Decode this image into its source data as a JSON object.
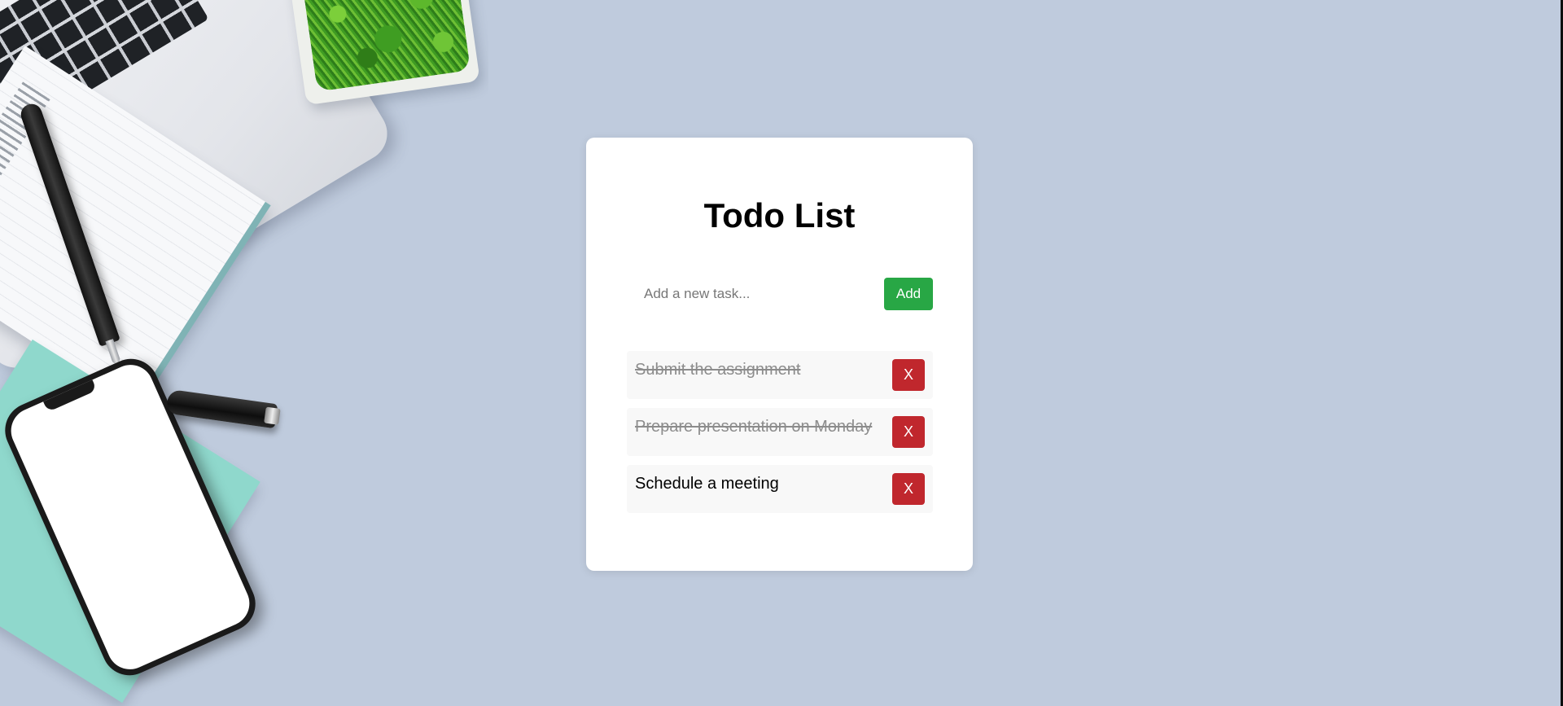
{
  "app": {
    "title": "Todo List",
    "add_label": "Add",
    "input": {
      "value": "",
      "placeholder": "Add a new task..."
    }
  },
  "tasks": [
    {
      "text": "Submit the assignment",
      "completed": true,
      "delete_label": "X"
    },
    {
      "text": "Prepare presentation on Monday",
      "completed": true,
      "delete_label": "X"
    },
    {
      "text": "Schedule a meeting",
      "completed": false,
      "delete_label": "X"
    }
  ],
  "colors": {
    "background": "#bfcbdd",
    "card": "#ffffff",
    "add_button": "#28a745",
    "delete_button": "#c0272d",
    "task_bg": "#f8f8f8",
    "completed_text": "#8c8c8c"
  }
}
